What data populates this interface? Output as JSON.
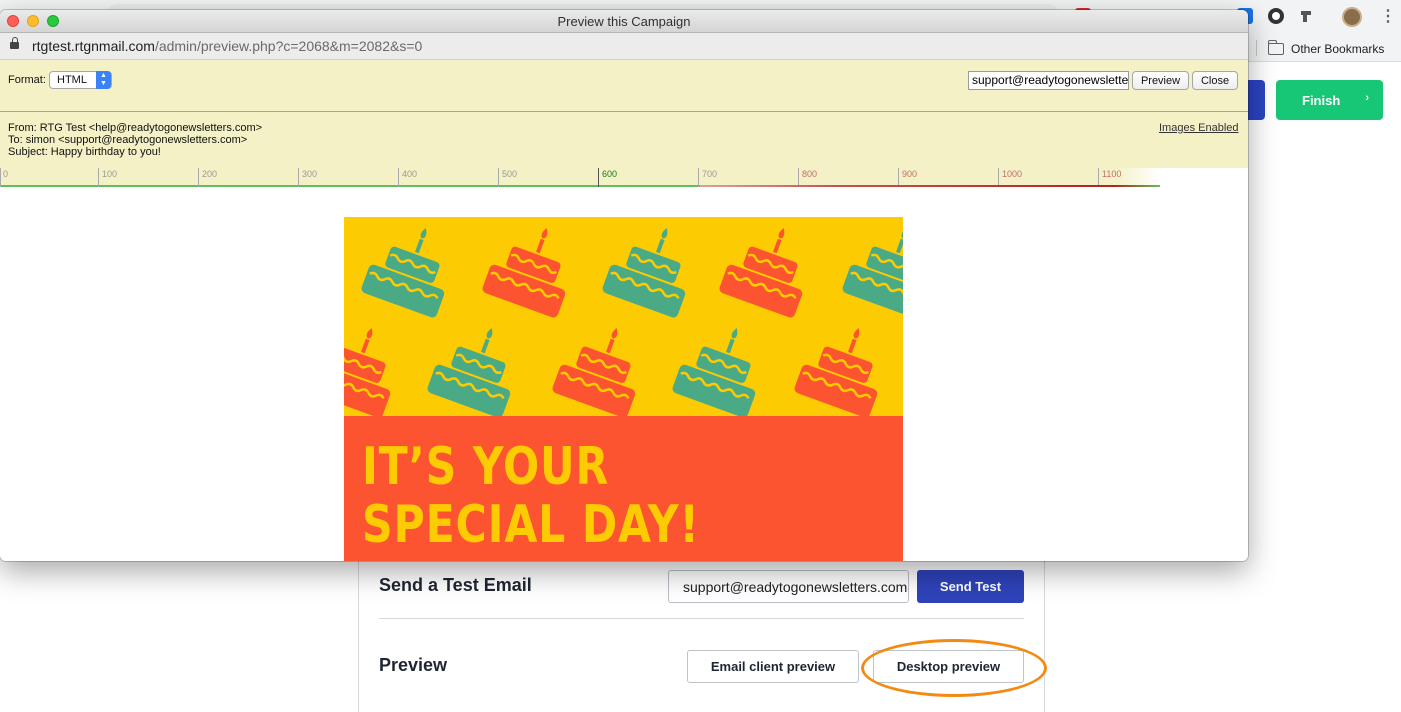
{
  "browser": {
    "bookmarks": {
      "other_label": "Other Bookmarks"
    }
  },
  "app": {
    "finish_label": "Finish",
    "test": {
      "title": "Send a Test Email",
      "email_value": "support@readytogonewsletters.com",
      "send_label": "Send Test"
    },
    "preview": {
      "title": "Preview",
      "email_client_label": "Email client preview",
      "desktop_label": "Desktop preview"
    },
    "colors": {
      "finish": "#18c776",
      "primary": "#2e43b9",
      "highlight": "#f28a13"
    }
  },
  "popup": {
    "title": "Preview this Campaign",
    "url": {
      "host": "rtgtest.rtgnmail.com",
      "path": "/admin/preview.php?c=2068&m=2082&s=0"
    },
    "format": {
      "label": "Format:",
      "value": "HTML"
    },
    "recipient_value": "support@readytogonewsletters.com",
    "preview_label": "Preview",
    "close_label": "Close",
    "headers": {
      "from": "From: RTG Test <help@readytogonewsletters.com>",
      "to": "To: simon <support@readytogonewsletters.com>",
      "subject": "Subject: Happy birthday to you!"
    },
    "images_enabled_label": "Images Enabled",
    "ruler": [
      "0",
      "100",
      "200",
      "300",
      "400",
      "500",
      "600",
      "700",
      "800",
      "900",
      "1000",
      "1100"
    ],
    "email": {
      "headline_line1": "IT’S YOUR",
      "headline_line2": "SPECIAL DAY!",
      "colors": {
        "yellow": "#fdcb02",
        "red": "#fc5330",
        "green": "#4aaa86"
      }
    }
  }
}
